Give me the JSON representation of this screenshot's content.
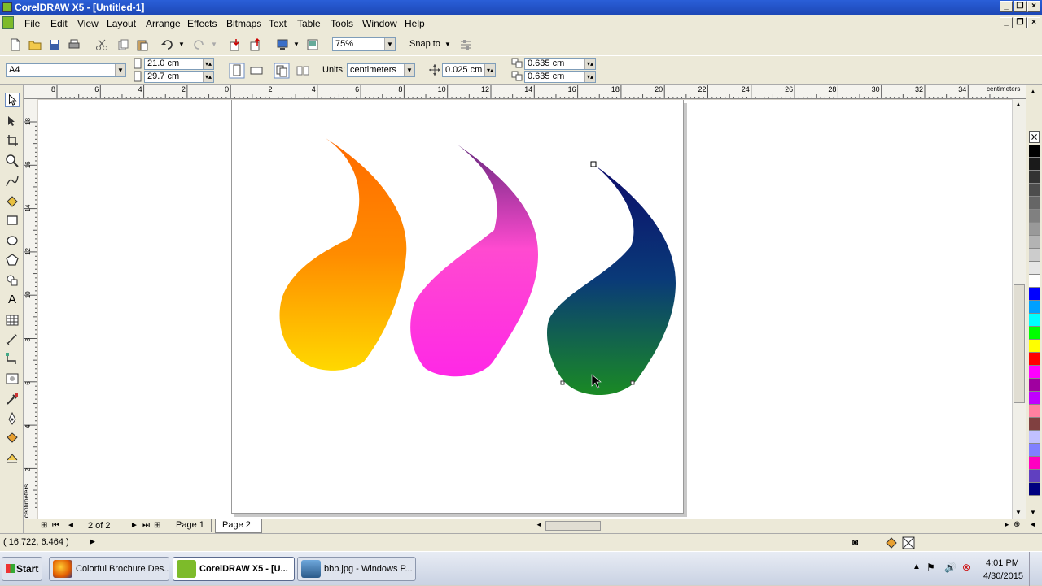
{
  "window": {
    "title": "CorelDRAW X5 - [Untitled-1]"
  },
  "menu": [
    "File",
    "Edit",
    "View",
    "Layout",
    "Arrange",
    "Effects",
    "Bitmaps",
    "Text",
    "Table",
    "Tools",
    "Window",
    "Help"
  ],
  "toolbar": {
    "zoom": "75%",
    "snap_to": "Snap to"
  },
  "property_bar": {
    "paper_size": "A4",
    "width": "21.0 cm",
    "height": "29.7 cm",
    "units_label": "Units:",
    "units_value": "centimeters",
    "nudge": "0.025 cm",
    "dup_x": "0.635 cm",
    "dup_y": "0.635 cm"
  },
  "rulers": {
    "h_ticks": [
      "8",
      "6",
      "4",
      "2",
      "0",
      "2",
      "4",
      "6",
      "8",
      "10",
      "12",
      "14",
      "16",
      "18",
      "20",
      "22",
      "24",
      "26",
      "28",
      "30",
      "32",
      "34"
    ],
    "h_unit": "centimeters",
    "v_ticks": [
      "18",
      "16",
      "14",
      "12",
      "10",
      "8",
      "6",
      "4",
      "2"
    ],
    "v_unit": "centimeters"
  },
  "page_nav": {
    "counter": "2 of 2",
    "tabs": [
      "Page 1",
      "Page 2"
    ],
    "active_tab": 1
  },
  "status": {
    "coords": "( 16.722, 6.464 )"
  },
  "palette_colors": [
    "#000000",
    "#1a1a1a",
    "#333333",
    "#4d4d4d",
    "#666666",
    "#808080",
    "#999999",
    "#b3b3b3",
    "#cccccc",
    "#e6e6e6",
    "#ffffff",
    "#0000ff",
    "#00a0ff",
    "#00ffff",
    "#00ff00",
    "#ffff00",
    "#ff0000",
    "#ff00ff",
    "#a000a0",
    "#c000ff",
    "#ff80a0",
    "#804040",
    "#c0c0ff",
    "#8080ff",
    "#ff00c0",
    "#6040c0",
    "#000080"
  ],
  "taskbar": {
    "start": "Start",
    "tasks": [
      "Colorful Brochure Des...",
      "CorelDRAW X5 - [U...",
      "bbb.jpg - Windows P..."
    ],
    "time": "4:01 PM",
    "date": "4/30/2015"
  }
}
